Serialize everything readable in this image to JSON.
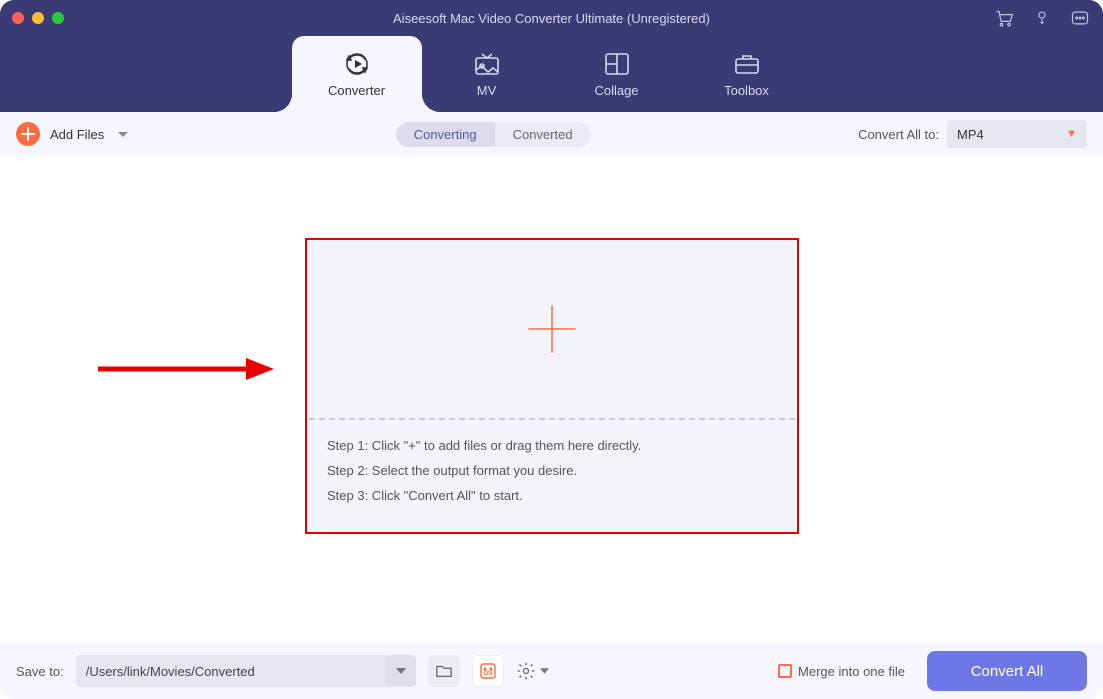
{
  "window": {
    "title": "Aiseesoft Mac Video Converter Ultimate (Unregistered)"
  },
  "tabs": [
    {
      "label": "Converter"
    },
    {
      "label": "MV"
    },
    {
      "label": "Collage"
    },
    {
      "label": "Toolbox"
    }
  ],
  "toolbar": {
    "add_files_label": "Add Files",
    "segments": {
      "converting": "Converting",
      "converted": "Converted"
    },
    "convert_all_to_label": "Convert All to:",
    "format_selected": "MP4"
  },
  "dropzone": {
    "step1": "Step 1: Click \"+\" to add files or drag them here directly.",
    "step2": "Step 2: Select the output format you desire.",
    "step3": "Step 3: Click \"Convert All\" to start."
  },
  "footer": {
    "save_to_label": "Save to:",
    "save_to_path": "/Users/link/Movies/Converted",
    "merge_label": "Merge into one file",
    "convert_all_label": "Convert All"
  }
}
